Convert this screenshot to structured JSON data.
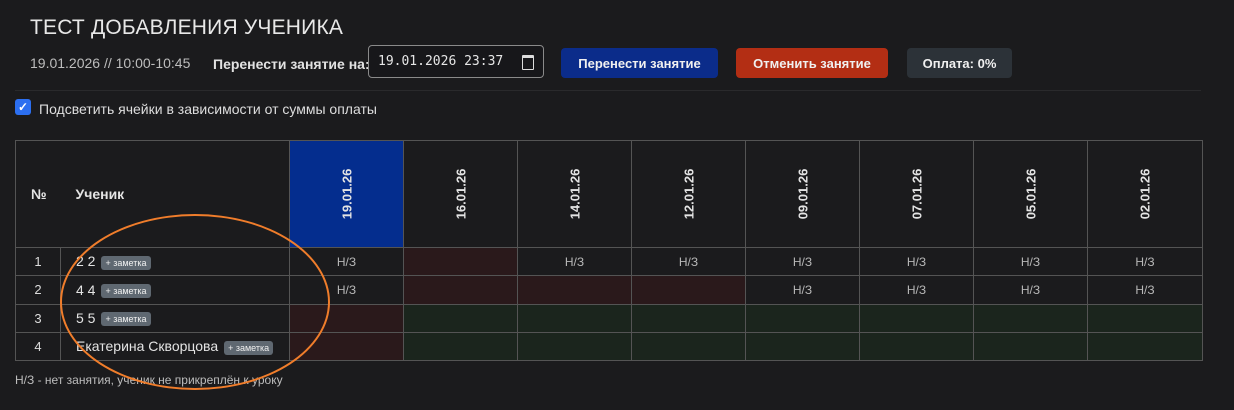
{
  "title": "ТЕСТ ДОБАВЛЕНИЯ УЧЕНИКА",
  "lesson_datetime": "19.01.2026 // 10:00-10:45",
  "reschedule": {
    "label": "Перенести занятие на:",
    "value": "19.01.2026  23:37"
  },
  "buttons": {
    "move": "Перенести занятие",
    "cancel": "Отменить занятие",
    "payment": "Оплата: 0%"
  },
  "highlight_checkbox": {
    "label": "Подсветить ячейки в зависимости от суммы оплаты",
    "checked": true
  },
  "table": {
    "col_num": "№",
    "col_student": "Ученик",
    "dates": [
      "19.01.26",
      "16.01.26",
      "14.01.26",
      "12.01.26",
      "09.01.26",
      "07.01.26",
      "05.01.26",
      "02.01.26"
    ],
    "active_date": "19.01.26",
    "note_label": "+ заметка",
    "rows": [
      {
        "num": "1",
        "name": "2 2",
        "cells": [
          "Н/З",
          "",
          "Н/З",
          "Н/З",
          "Н/З",
          "Н/З",
          "Н/З",
          "Н/З"
        ],
        "colors": [
          "",
          "red",
          "",
          "",
          "",
          "",
          "",
          ""
        ]
      },
      {
        "num": "2",
        "name": "4 4",
        "cells": [
          "Н/З",
          "",
          "",
          "",
          "Н/З",
          "Н/З",
          "Н/З",
          "Н/З"
        ],
        "colors": [
          "",
          "red",
          "red",
          "red",
          "",
          "",
          "",
          ""
        ]
      },
      {
        "num": "3",
        "name": "5 5",
        "cells": [
          "",
          "",
          "",
          "",
          "",
          "",
          "",
          ""
        ],
        "colors": [
          "red",
          "green",
          "green",
          "green",
          "green",
          "green",
          "green",
          "green"
        ]
      },
      {
        "num": "4",
        "name": "Екатерина Скворцова",
        "cells": [
          "",
          "",
          "",
          "",
          "",
          "",
          "",
          ""
        ],
        "colors": [
          "red",
          "green",
          "green",
          "green",
          "green",
          "green",
          "green",
          "green"
        ]
      }
    ]
  },
  "footnote": "Н/З - нет занятия, ученик не прикреплён к уроку",
  "colors": {
    "active_date": "#042d8e",
    "move_button": "#0b2c8a",
    "cancel_button": "#b32e14",
    "annotation": "#f07d2b"
  }
}
